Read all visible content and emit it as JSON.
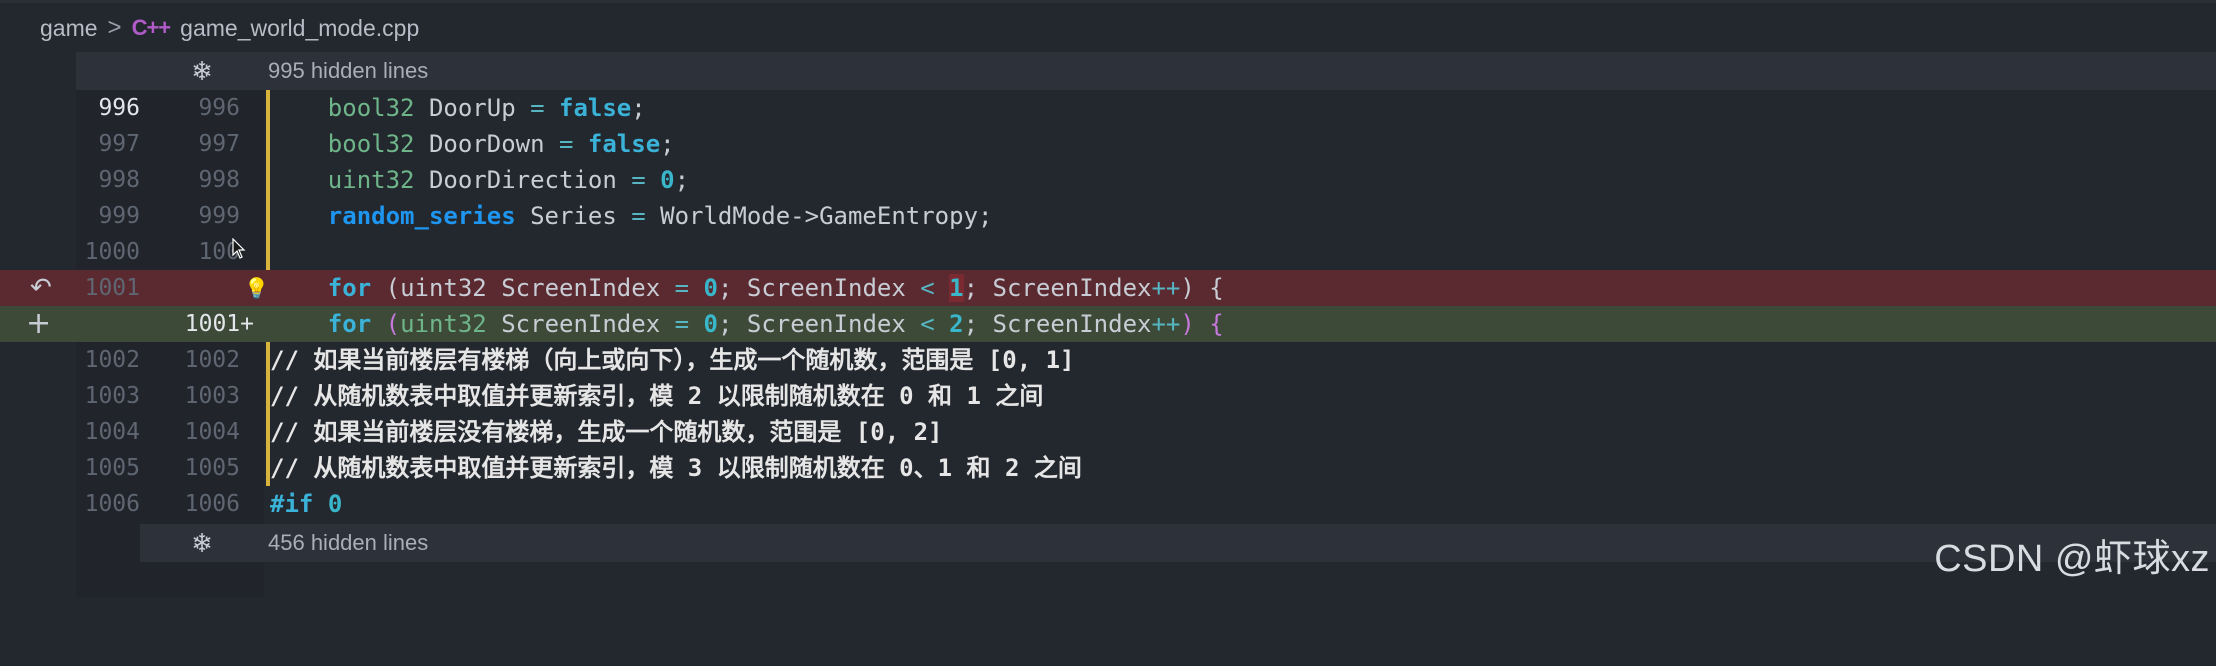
{
  "breadcrumb": {
    "folder": "game",
    "separator": ">",
    "file_icon": "C++",
    "file": "game_world_mode.cpp"
  },
  "fold_top": {
    "icon": "fold-icon",
    "label": "995 hidden lines"
  },
  "fold_bottom": {
    "icon": "fold-icon",
    "label": "456 hidden lines"
  },
  "lines": {
    "l996": {
      "a": "996",
      "b": "996"
    },
    "l997": {
      "a": "997",
      "b": "997"
    },
    "l998": {
      "a": "998",
      "b": "998"
    },
    "l999": {
      "a": "999",
      "b": "999"
    },
    "l1000": {
      "a": "1000",
      "b": "100"
    },
    "l1001del": {
      "a": "1001",
      "b": ""
    },
    "l1001add": {
      "a": "",
      "b": "1001+"
    },
    "l1002": {
      "a": "1002",
      "b": "1002"
    },
    "l1003": {
      "a": "1003",
      "b": "1003"
    },
    "l1004": {
      "a": "1004",
      "b": "1004"
    },
    "l1005": {
      "a": "1005",
      "b": "1005"
    },
    "l1006": {
      "a": "1006",
      "b": "1006"
    }
  },
  "code": {
    "t_bool32": "bool32",
    "t_uint32": "uint32",
    "t_random_series": "random_series",
    "door_up": " DoorUp ",
    "door_down": " DoorDown ",
    "door_dir": " DoorDirection ",
    "series": " Series ",
    "eq": "=",
    "false": "false",
    "zero": "0",
    "one": "1",
    "two": "2",
    "semi": ";",
    "world_entropy": " WorldMode->GameEntropy;",
    "kw_for": "for",
    "open_paren": "(",
    "close_paren": ")",
    "screen_index": " ScreenIndex ",
    "screen_index_lt": "; ScreenIndex ",
    "lt": "<",
    "screen_index_pp": "; ScreenIndex",
    "pp": "++",
    "open_brace": "{",
    "comment_1002": "// 如果当前楼层有楼梯（向上或向下），生成一个随机数，范围是 [0, 1]",
    "comment_1003": "// 从随机数表中取值并更新索引，模 2 以限制随机数在 0 和 1 之间",
    "comment_1004": "// 如果当前楼层没有楼梯，生成一个随机数，范围是 [0, 2]",
    "comment_1005": "// 从随机数表中取值并更新索引，模 3 以限制随机数在 0、1 和 2 之间",
    "pre_if": "#if",
    "pre_if_val": "0"
  },
  "watermark": "CSDN @虾球xz"
}
